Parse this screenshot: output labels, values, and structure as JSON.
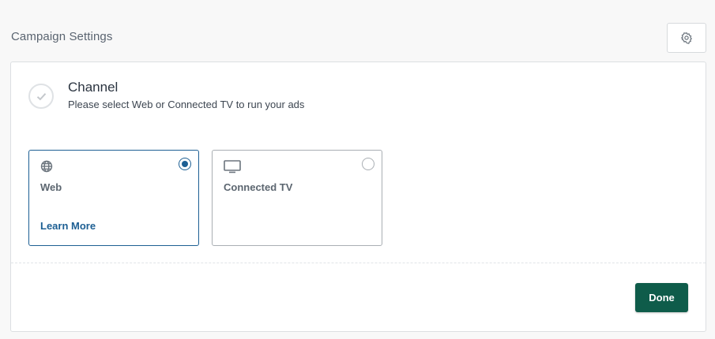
{
  "page": {
    "title": "Campaign Settings"
  },
  "header": {
    "settings_icon": "gear-icon"
  },
  "channel": {
    "title": "Channel",
    "subtitle": "Please select Web or Connected TV to run your ads",
    "status_icon": "check-icon",
    "options": [
      {
        "label": "Web",
        "icon": "globe-icon",
        "link": "Learn More",
        "selected": true
      },
      {
        "label": "Connected TV",
        "icon": "tv-icon",
        "selected": false
      }
    ]
  },
  "footer": {
    "done_label": "Done"
  },
  "colors": {
    "accent": "#1d5f93",
    "primary_button": "#0f5c4a",
    "background": "#f8f8f8",
    "border": "#dcdfe2"
  }
}
